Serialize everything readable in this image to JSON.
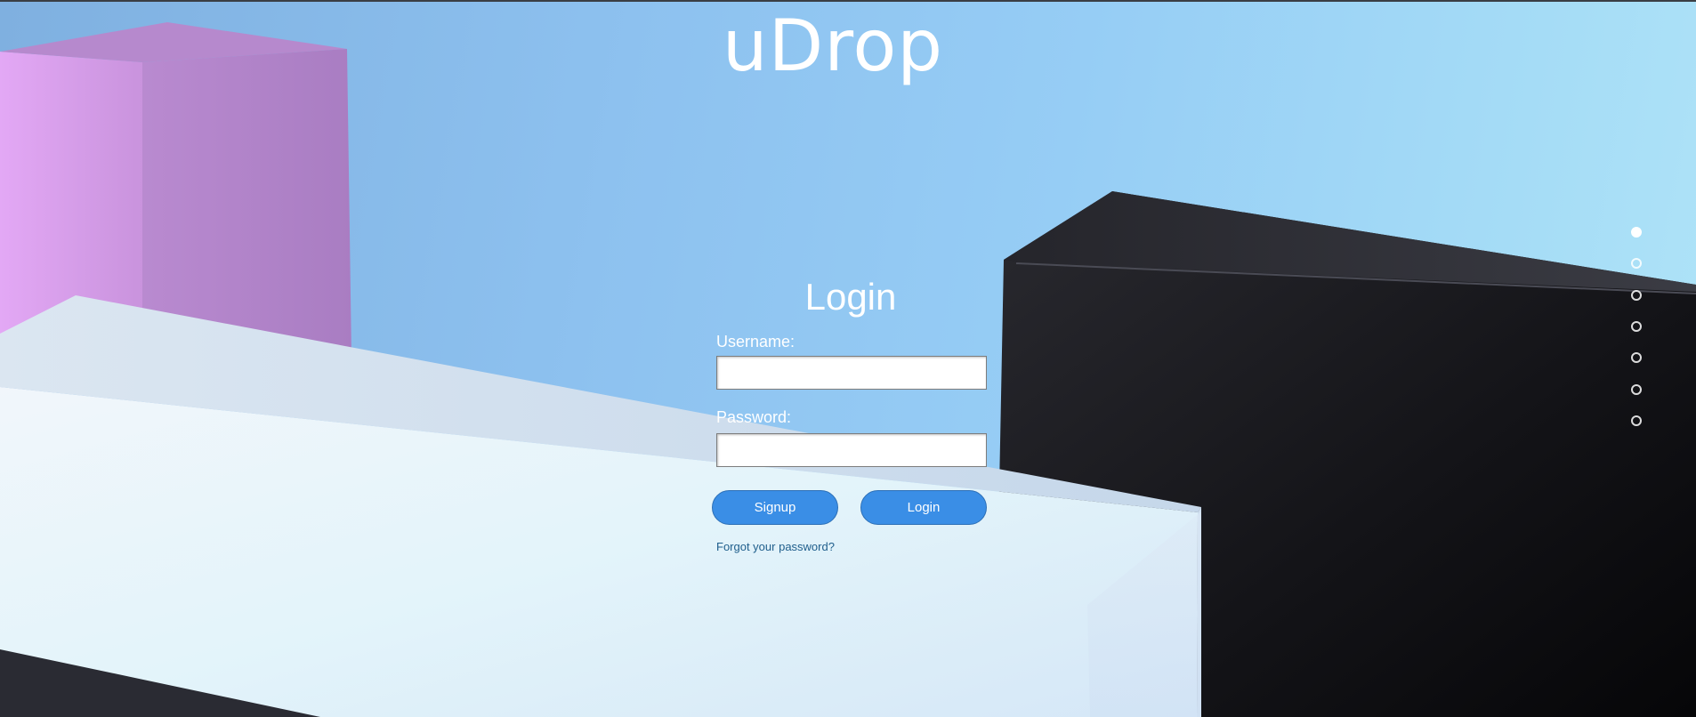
{
  "brand": {
    "logo_text": "uDrop"
  },
  "login_form": {
    "title": "Login",
    "username_label": "Username:",
    "username_value": "",
    "password_label": "Password:",
    "password_value": "",
    "signup_button": "Signup",
    "login_button": "Login",
    "forgot_link": "Forgot your password?"
  },
  "slide_nav": {
    "count": 7,
    "active_index": 0
  },
  "colors": {
    "accent": "#3a8ee6",
    "link": "#1f5e8c",
    "background": "#8dc1ef"
  }
}
